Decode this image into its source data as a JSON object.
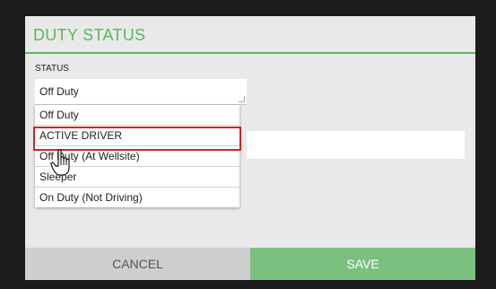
{
  "dialog": {
    "title": "DUTY STATUS",
    "status_label": "STATUS",
    "selected_value": "Off Duty"
  },
  "dropdown": {
    "options": [
      {
        "label": "Off Duty"
      },
      {
        "label": "ACTIVE DRIVER"
      },
      {
        "label": "Off Duty (At Wellsite)"
      },
      {
        "label": "Sleeper"
      },
      {
        "label": "On Duty (Not Driving)"
      }
    ],
    "highlighted_option": "ACTIVE DRIVER"
  },
  "footer": {
    "cancel_label": "CANCEL",
    "save_label": "SAVE"
  },
  "colors": {
    "accent": "#5cb85c",
    "save_button": "#7cc07f",
    "cancel_button": "#cfcfcf",
    "highlight": "#c62828"
  },
  "icons": {
    "cursor": "hand-pointer-icon"
  }
}
